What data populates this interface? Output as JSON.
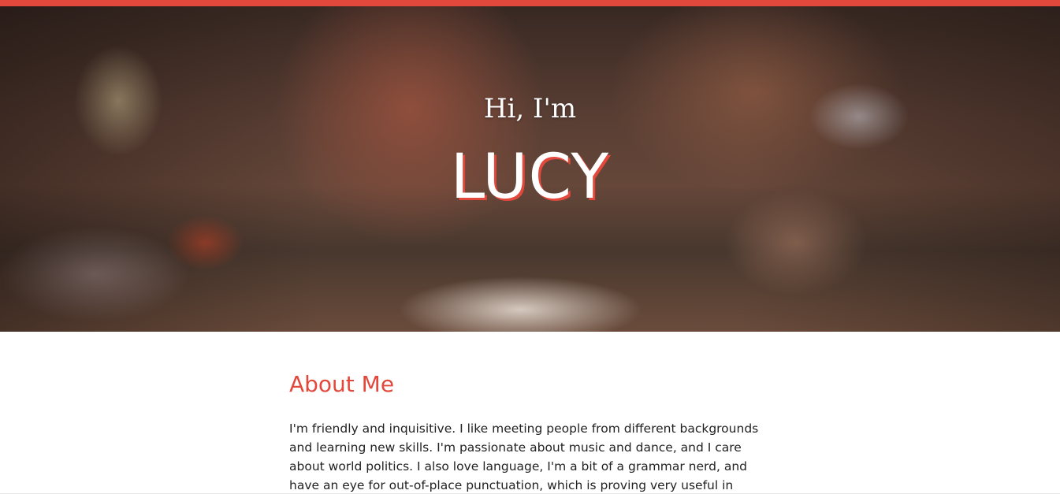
{
  "colors": {
    "accent": "#e2483b",
    "body_text": "#222222",
    "background": "#ffffff"
  },
  "hero": {
    "greeting": "Hi, I'm",
    "name": "LUCY"
  },
  "about": {
    "heading": "About Me",
    "text": "I'm friendly and inquisitive. I like meeting people from different backgrounds and learning new skills. I'm passionate about music and dance, and I care about world politics. I also love language, I'm a bit of a grammar nerd, and have an eye for out-of-place punctuation, which is proving very useful in coding!"
  }
}
